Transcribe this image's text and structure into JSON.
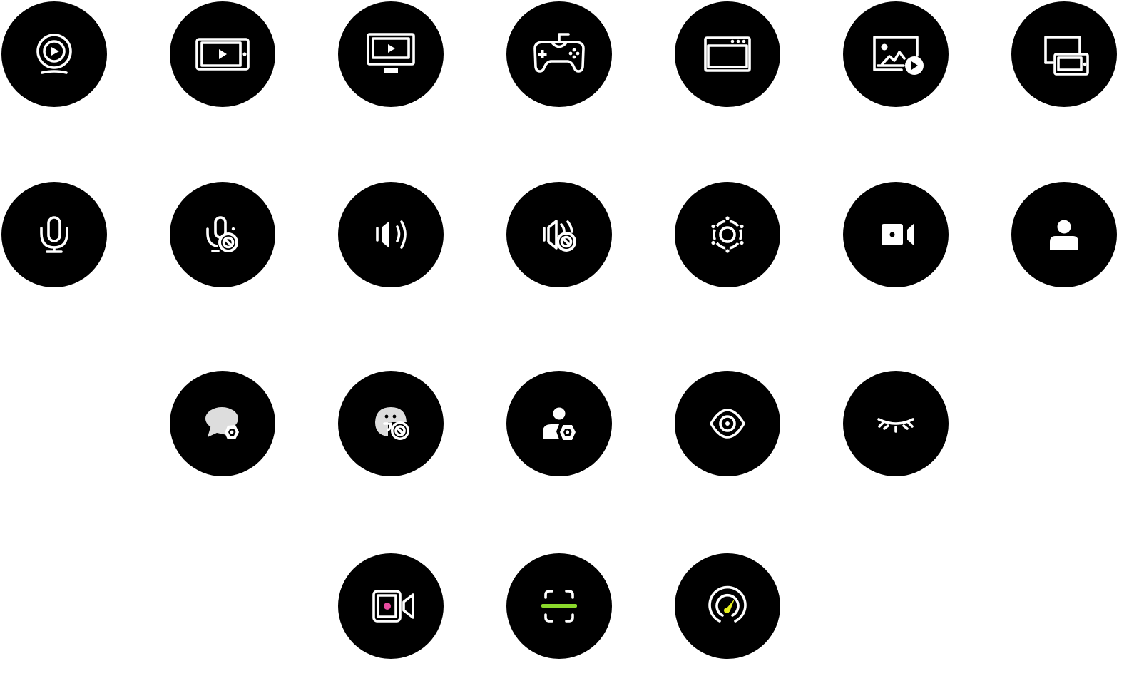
{
  "icon_grid": {
    "rows": [
      {
        "items": [
          {
            "icon": "webcam-broadcast-icon"
          },
          {
            "icon": "tablet-video-icon"
          },
          {
            "icon": "monitor-video-icon"
          },
          {
            "icon": "gamepad-icon"
          },
          {
            "icon": "browser-window-icon"
          },
          {
            "icon": "image-video-icon"
          },
          {
            "icon": "multi-screen-icon"
          }
        ]
      },
      {
        "items": [
          {
            "icon": "microphone-icon"
          },
          {
            "icon": "microphone-blocked-icon"
          },
          {
            "icon": "speaker-icon"
          },
          {
            "icon": "speaker-blocked-icon"
          },
          {
            "icon": "gear-icon"
          },
          {
            "icon": "camera-icon"
          },
          {
            "icon": "user-icon"
          }
        ]
      },
      {
        "items": [
          {
            "icon": "chat-settings-icon"
          },
          {
            "icon": "emoji-blocked-icon"
          },
          {
            "icon": "user-settings-icon"
          },
          {
            "icon": "eye-icon"
          },
          {
            "icon": "eye-closed-icon"
          }
        ]
      },
      {
        "items": [
          {
            "icon": "record-camera-icon"
          },
          {
            "icon": "scan-frame-icon"
          },
          {
            "icon": "performance-gauge-icon"
          }
        ]
      }
    ]
  },
  "colors": {
    "button_background": "#000000",
    "glyph": "#ffffff",
    "page_background": "#ffffff",
    "record_dot": "#e94ca0",
    "scan_line": "#8ad82b",
    "gauge_needle": "#e6f01d"
  }
}
